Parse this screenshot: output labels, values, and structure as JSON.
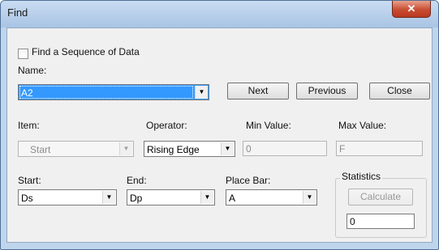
{
  "window": {
    "title": "Find",
    "close_glyph": "✕"
  },
  "find_sequence": {
    "label": "Find a Sequence of Data",
    "checked": false
  },
  "name": {
    "label": "Name:",
    "value": "A2"
  },
  "buttons": {
    "next": "Next",
    "previous": "Previous",
    "close": "Close",
    "calculate": "Calculate"
  },
  "item": {
    "label": "Item:",
    "value": "Start"
  },
  "operator": {
    "label": "Operator:",
    "value": "Rising Edge"
  },
  "min_value": {
    "label": "Min Value:",
    "value": "0"
  },
  "max_value": {
    "label": "Max Value:",
    "value": "F"
  },
  "start": {
    "label": "Start:",
    "value": "Ds"
  },
  "end": {
    "label": "End:",
    "value": "Dp"
  },
  "place_bar": {
    "label": "Place Bar:",
    "value": "A"
  },
  "statistics": {
    "label": "Statistics",
    "result": "0"
  },
  "icons": {
    "dropdown": "chevron-down-icon",
    "close": "close-icon",
    "checkbox": "checkbox-icon"
  }
}
